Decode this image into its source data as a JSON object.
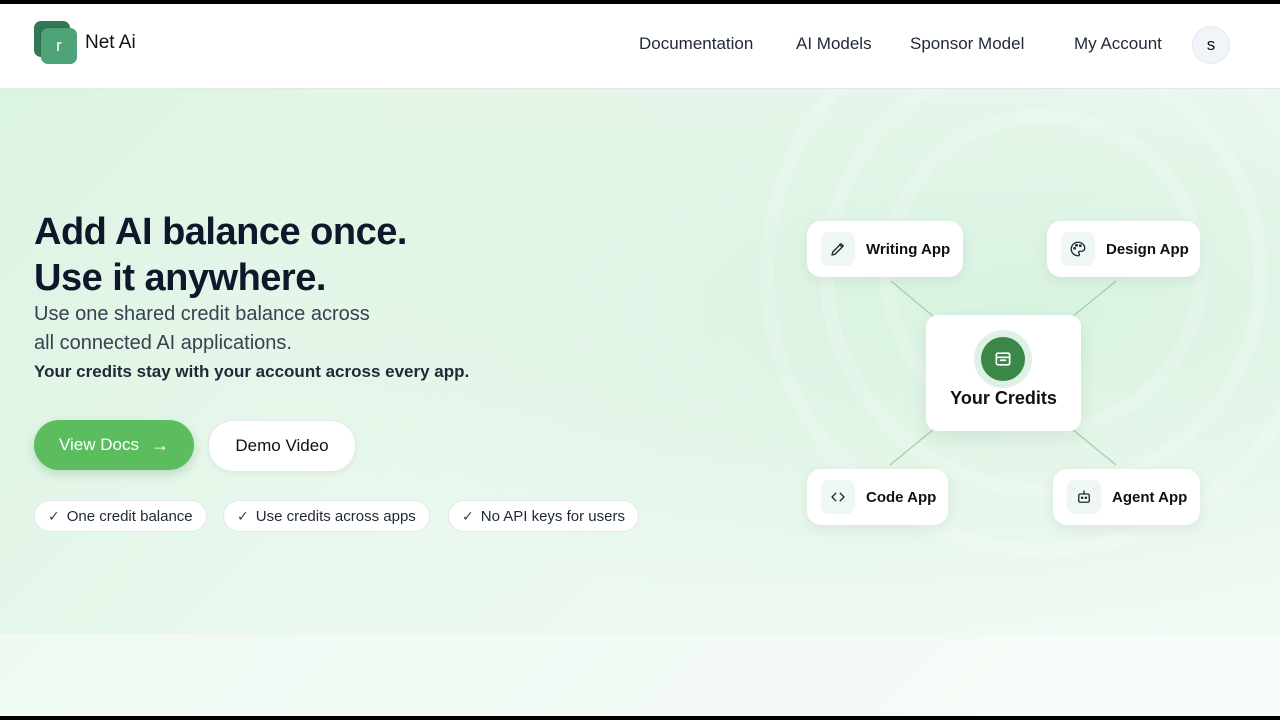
{
  "header": {
    "logo_letter": "r",
    "brand": "Net Ai",
    "nav": {
      "documentation": "Documentation",
      "ai_models": "AI Models",
      "sponsor_model": "Sponsor Model",
      "my_account": "My Account"
    },
    "avatar_letter": "s"
  },
  "hero": {
    "headline_line1": "Add AI balance once.",
    "headline_line2": "Use it anywhere.",
    "sub_line1": "Use one shared credit balance across",
    "sub_line2": "all connected AI applications.",
    "note": "Your credits stay with your account across every app.",
    "primary_button": "View Docs",
    "secondary_button": "Demo Video",
    "features": [
      "One credit balance",
      "Use credits across apps",
      "No API keys for users"
    ]
  },
  "diagram": {
    "center": {
      "label": "Your Credits",
      "icon": "wallet-icon"
    },
    "apps": [
      {
        "label": "Writing App",
        "icon": "pencil-icon"
      },
      {
        "label": "Design App",
        "icon": "palette-icon"
      },
      {
        "label": "Code App",
        "icon": "code-icon"
      },
      {
        "label": "Agent App",
        "icon": "robot-icon"
      }
    ]
  },
  "colors": {
    "brand_green": "#3b8748",
    "primary_button": "#5cbd5e",
    "hero_background": "#e3f6e8"
  }
}
